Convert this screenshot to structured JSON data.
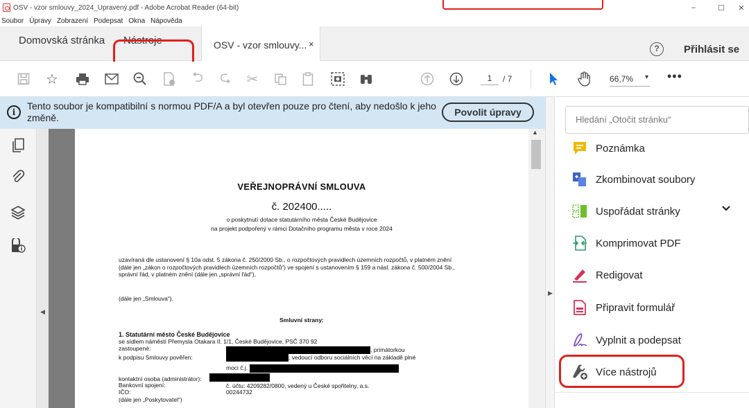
{
  "window": {
    "title": "OSV - vzor smlouvy_2024_Upravený.pdf - Adobe Acrobat Reader (64-bit)",
    "minimize": "–",
    "maximize": "☐",
    "close": "✕"
  },
  "menu": [
    "Soubor",
    "Úpravy",
    "Zobrazení",
    "Podepsat",
    "Okna",
    "Nápověda"
  ],
  "tabs": {
    "home": "Domovská stránka",
    "tools": "Nástroje",
    "document": "OSV - vzor smlouvy...",
    "close": "×"
  },
  "header": {
    "help": "?",
    "signin": "Přihlásit se"
  },
  "toolbar": {
    "page_current": "1",
    "page_total": "/ 7",
    "zoom": "66,7%",
    "zoom_arrow": "▾",
    "more": "•••",
    "icons": [
      "save-icon",
      "star-icon",
      "print-icon",
      "mail-icon",
      "zoom-out-icon",
      "certify-icon",
      "undo-icon",
      "redo-icon",
      "cut-icon",
      "copy-icon",
      "paste-icon",
      "snapshot-icon",
      "find-icon",
      "page-up-icon",
      "page-down-icon",
      "select-arrow-icon",
      "hand-icon"
    ]
  },
  "infobar": {
    "message": "Tento soubor je kompatibilní s normou PDF/A a byl otevřen pouze pro čtení, aby nedošlo k jeho změně.",
    "button": "Povolit úpravy"
  },
  "document": {
    "title": "VEŘEJNOPRÁVNÍ SMLOUVA",
    "number": "č. 202400.....",
    "subtitle1": "o poskytnutí dotace statutárního města České Budějovice",
    "subtitle2": "na projekt podpořený v rámci Dotačního programu města v roce 2024",
    "paragraph": "uzavíraná dle ustanovení § 10a odst. 5 zákona č. 250/2000 Sb., o rozpočtových pravidlech územních rozpočtů, v platném znění (dále jen „zákon o rozpočtových pravidlech územních rozpočtů“) ve spojení s ustanovením § 159 a násl. zákona č. 500/2004 Sb., správní řád, v platném znění (dále jen „správní řád“),",
    "smlouva": "(dále jen „Smlouva“).",
    "strany": "Smluvní strany:",
    "party_title": "1.  Statutární město České Budějovice",
    "seat": "se sídlem náměstí Přemysla Otakara II. 1/1, České Budějovice, PSČ 370 92",
    "represented": "zastoupené:",
    "mayor": ", primátorkou",
    "authorized": "k podpisu Smlouvy pověřen:",
    "head_office": ", vedoucí odboru sociálních věcí na základě plné",
    "power": "moci č.j.",
    "contact": "kontaktní osoba (administrátor):",
    "bank_label": "Bankovní spojení:",
    "bank_value": "č. účtu: 4209282/0800, vedený u České spořitelny, a.s.",
    "ico_label": "IČO:",
    "ico_value": "00244732",
    "provider": "(dále jen „Poskytovatel“)"
  },
  "tools_panel": {
    "search_placeholder": "Hledání „Otočit stránku“",
    "items": [
      {
        "label": "Poznámka",
        "icon": "comment-icon",
        "color": "#f0b800"
      },
      {
        "label": "Zkombinovat soubory",
        "icon": "combine-files-icon",
        "color": "#3b63c4"
      },
      {
        "label": "Uspořádat stránky",
        "icon": "organize-pages-icon",
        "color": "#6bbf2a"
      },
      {
        "label": "Komprimovat PDF",
        "icon": "compress-pdf-icon",
        "color": "#2d9c6c"
      },
      {
        "label": "Redigovat",
        "icon": "redact-icon",
        "color": "#d4325c"
      },
      {
        "label": "Připravit formulář",
        "icon": "prepare-form-icon",
        "color": "#d4325c"
      },
      {
        "label": "Vyplnit a podepsat",
        "icon": "fill-sign-icon",
        "color": "#7b4fc8"
      },
      {
        "label": "Více nástrojů",
        "icon": "more-tools-icon",
        "color": "#444444"
      }
    ],
    "chevron": "❯"
  },
  "colors": {
    "annotation": "#e0201c",
    "infobar": "#d4e6f4",
    "select_arrow": "#1473e6"
  }
}
